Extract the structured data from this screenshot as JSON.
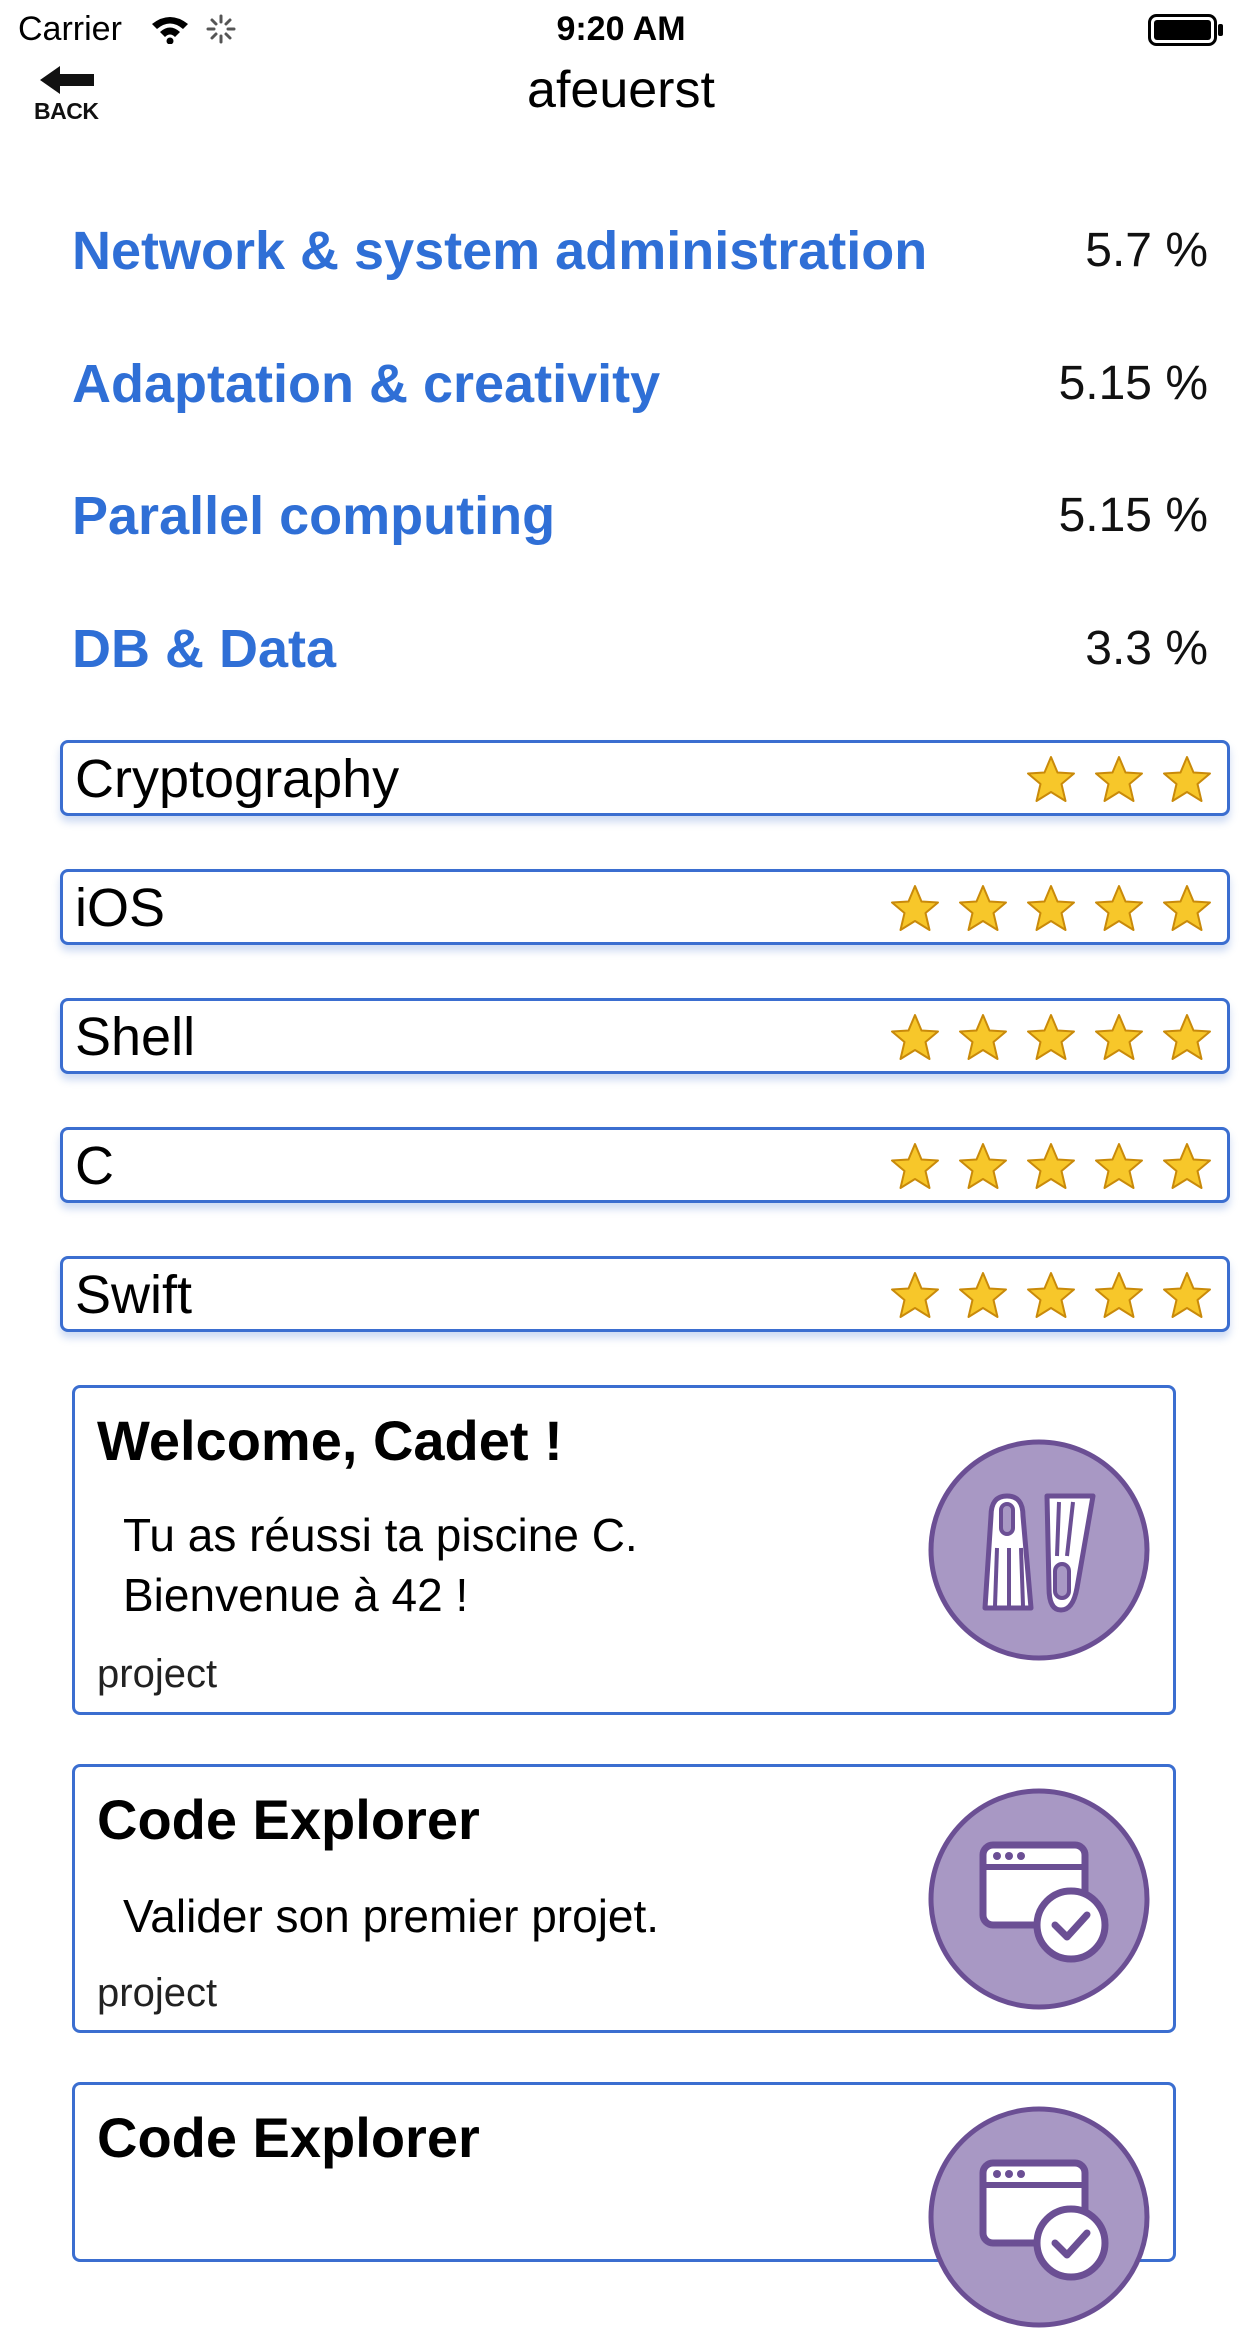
{
  "status_bar": {
    "carrier": "Carrier",
    "time": "9:20 AM"
  },
  "nav": {
    "back_label": "BACK",
    "title": "afeuerst"
  },
  "colors": {
    "accent": "#2f6fd6",
    "card_border": "#3b6ed0",
    "badge_fill": "#a898c4",
    "badge_stroke": "#6b4f94",
    "star": "#f7c72a"
  },
  "skills": [
    {
      "name": "Network & system administration",
      "value": "5.7 %"
    },
    {
      "name": "Adaptation & creativity",
      "value": "5.15 %"
    },
    {
      "name": "Parallel computing",
      "value": "5.15 %"
    },
    {
      "name": "DB & Data",
      "value": "3.3 %"
    }
  ],
  "languages": [
    {
      "name": "Cryptography",
      "stars": 3
    },
    {
      "name": "iOS",
      "stars": 5
    },
    {
      "name": "Shell",
      "stars": 5
    },
    {
      "name": "C",
      "stars": 5
    },
    {
      "name": "Swift",
      "stars": 5
    }
  ],
  "achievements": [
    {
      "title": "Welcome, Cadet !",
      "description_lines": [
        "Tu as réussi ta piscine C.",
        "Bienvenue à 42 !"
      ],
      "kind": "project",
      "icon": "flippers-icon"
    },
    {
      "title": "Code Explorer",
      "description_lines": [
        "Valider son premier projet."
      ],
      "kind": "project",
      "icon": "code-explorer-icon"
    },
    {
      "title": "Code Explorer",
      "description_lines": [],
      "kind": "",
      "icon": "code-explorer-icon"
    }
  ]
}
